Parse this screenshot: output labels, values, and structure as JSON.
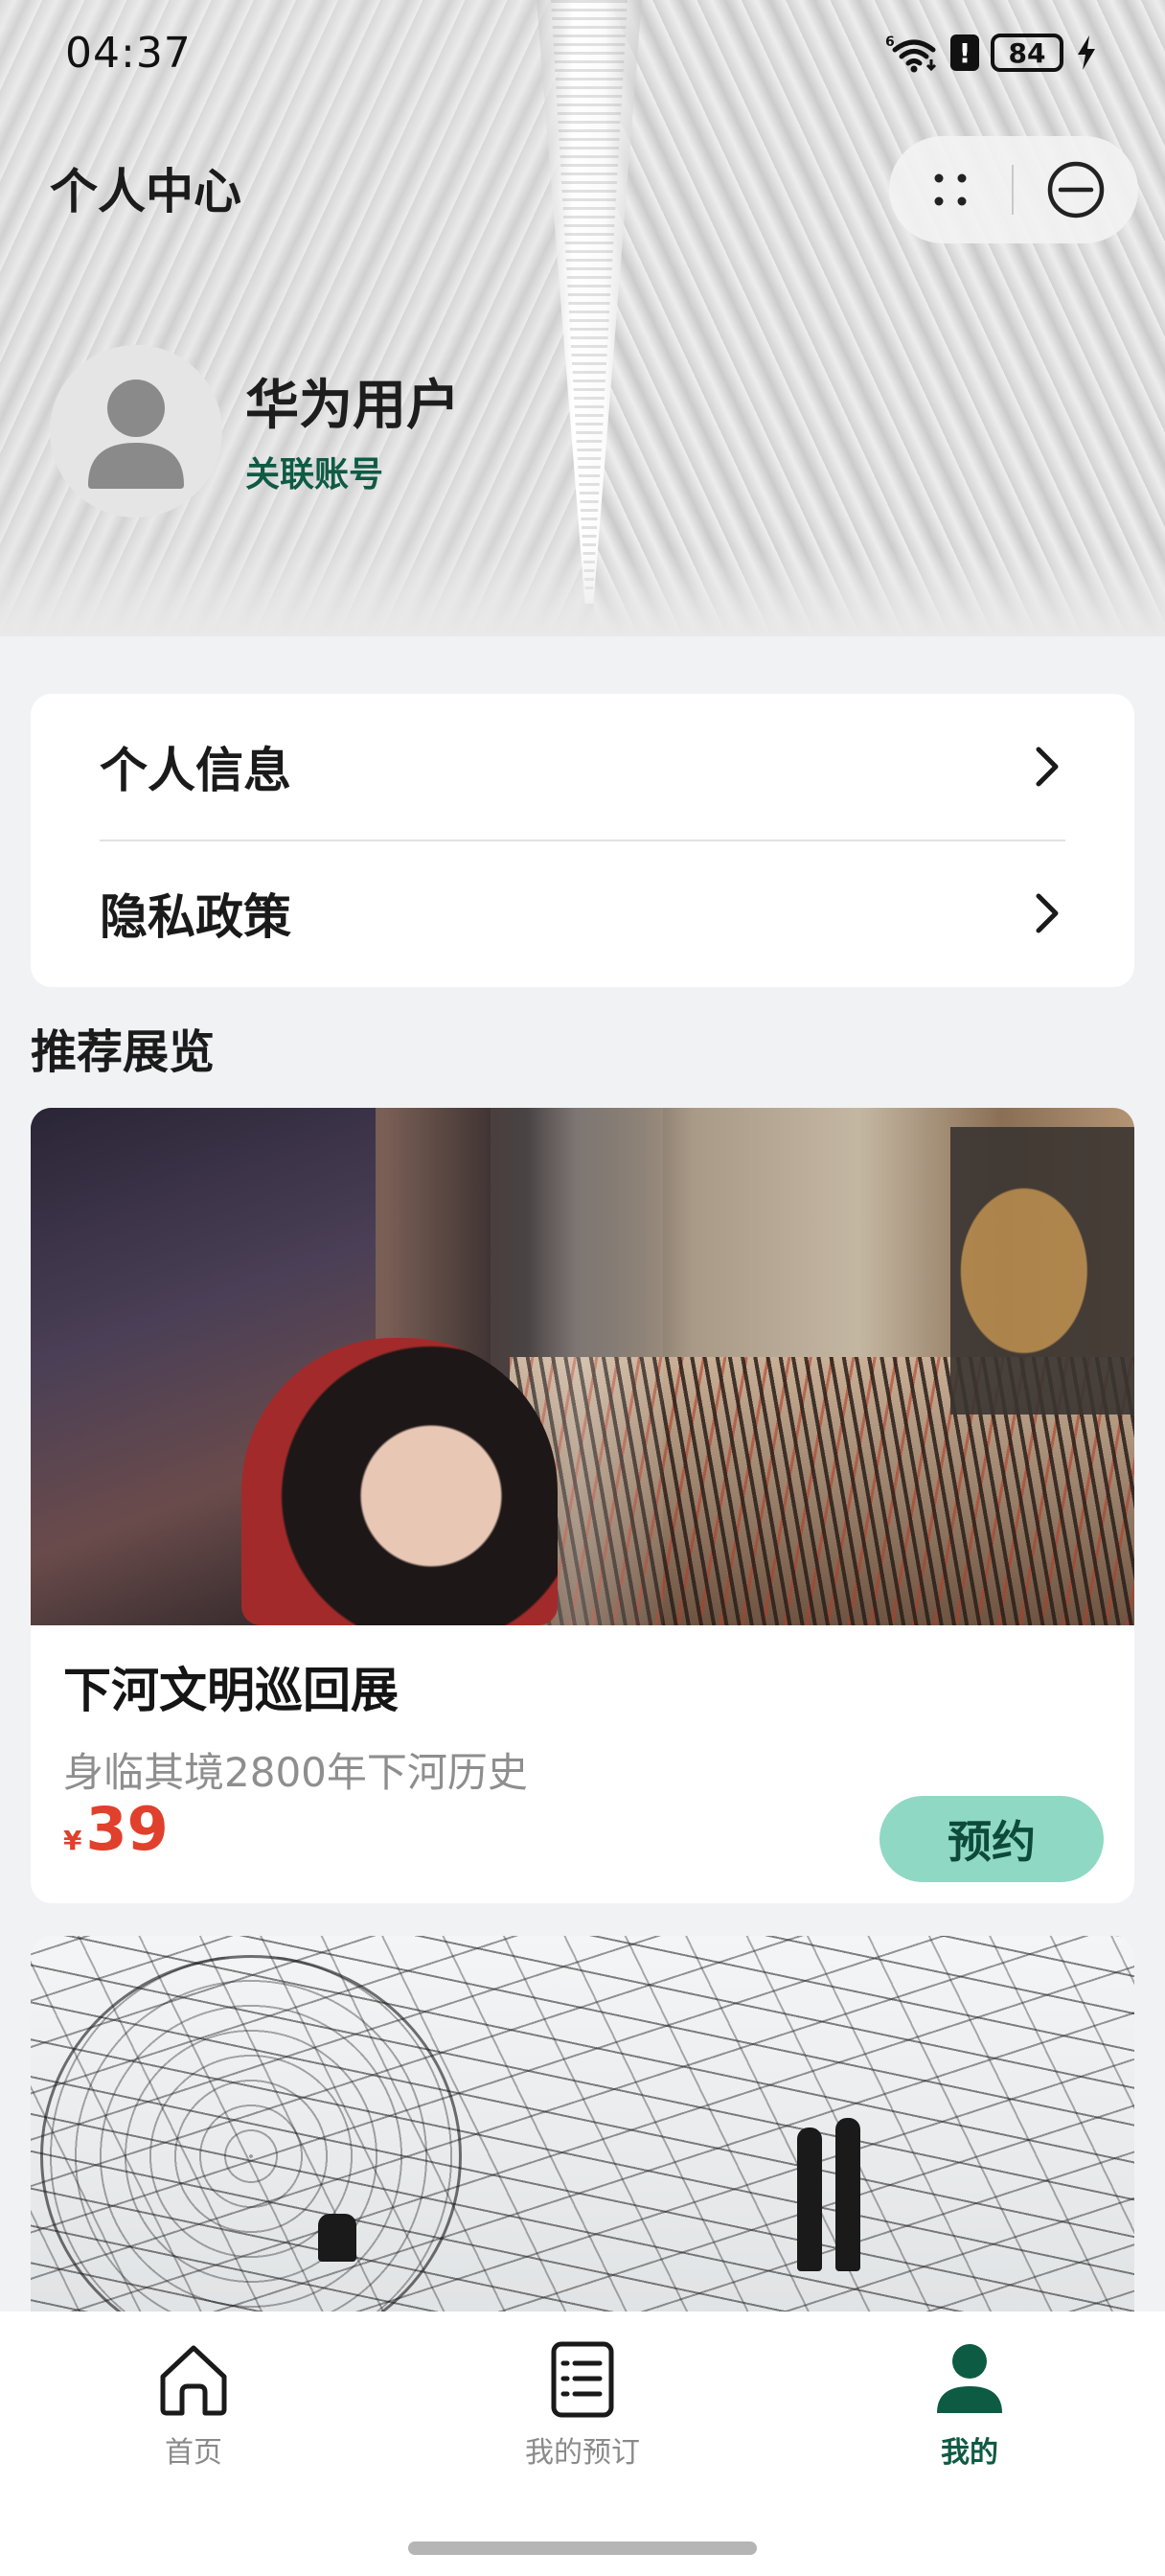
{
  "status_bar": {
    "time": "04:37",
    "battery": "84",
    "alert": "!"
  },
  "header": {
    "title": "个人中心",
    "user_name": "华为用户",
    "link_account": "关联账号"
  },
  "menu": {
    "items": [
      {
        "label": "个人信息",
        "icon": "chevron-right-icon"
      },
      {
        "label": "隐私政策",
        "icon": "chevron-right-icon"
      }
    ]
  },
  "recommend": {
    "section_title": "推荐展览",
    "cards": [
      {
        "title": "下河文明巡回展",
        "description": "身临其境2800年下河历史",
        "currency": "¥",
        "price": "39",
        "button_label": "预约"
      }
    ]
  },
  "tab_bar": {
    "tabs": [
      {
        "label": "首页",
        "icon": "home-icon",
        "active": false
      },
      {
        "label": "我的预订",
        "icon": "list-icon",
        "active": false
      },
      {
        "label": "我的",
        "icon": "user-icon",
        "active": true
      }
    ]
  },
  "colors": {
    "accent": "#0e5b43",
    "button_bg": "#8fd8c4",
    "price": "#e0402c",
    "background": "#f1f2f4"
  }
}
